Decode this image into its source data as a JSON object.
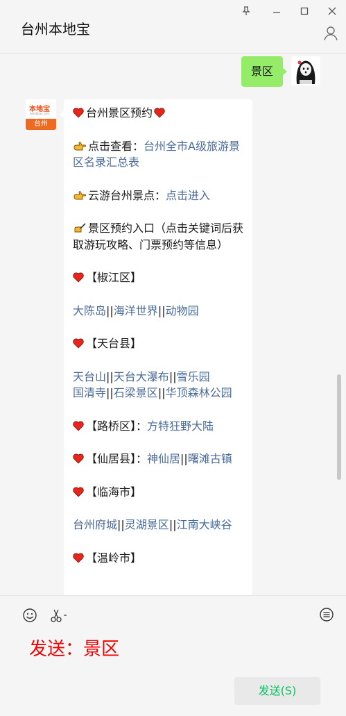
{
  "window": {
    "title": "台州本地宝",
    "controls": {
      "pin": "pin-icon",
      "minimize": "minimize-icon",
      "maximize": "maximize-icon",
      "close": "close-icon"
    }
  },
  "chat": {
    "outgoing": {
      "text": "景区"
    },
    "bot": {
      "avatar": {
        "brand": "本地宝",
        "sub": "bendibao.com",
        "city": "台州"
      },
      "lines": {
        "title": "台州景区预约",
        "view_prefix": "点击查看：",
        "view_link": "台州全市A级旅游景区名录汇总表",
        "cloud_prefix": "云游台州景点：",
        "cloud_link": "点击进入",
        "reserve_text": "景区预约入口（点击关键词后获取游玩攻略、门票预约等信息）",
        "jiaojiang": "【椒江区】",
        "jiaojiang_links": [
          "大陈岛",
          "海洋世界",
          "动物园"
        ],
        "tiantai": "【天台县】",
        "tiantai_links1": [
          "天台山",
          "天台大瀑布",
          "雪乐园"
        ],
        "tiantai_links2": [
          "国清寺",
          "石梁景区",
          "华顶森林公园"
        ],
        "luqiao": "【路桥区】：",
        "luqiao_link": "方特狂野大陆",
        "xianju": "【仙居县】：",
        "xianju_links": [
          "神仙居",
          "曙滩古镇"
        ],
        "linhai": "【临海市】",
        "linhai_links": [
          "台州府城",
          "灵湖景区",
          "江南大峡谷"
        ],
        "wenling": "【温岭市】"
      },
      "separator": "||"
    }
  },
  "input": {
    "typed_text": "发送：景区",
    "send_label": "发送(S)",
    "tools": [
      "emoji-icon",
      "scissors-icon",
      "chat-history-icon"
    ]
  },
  "colors": {
    "accent": "#07c160",
    "bubble_me": "#95ec69",
    "link": "#4a6a96",
    "typed": "#f20000",
    "heart": "#e8251b"
  }
}
